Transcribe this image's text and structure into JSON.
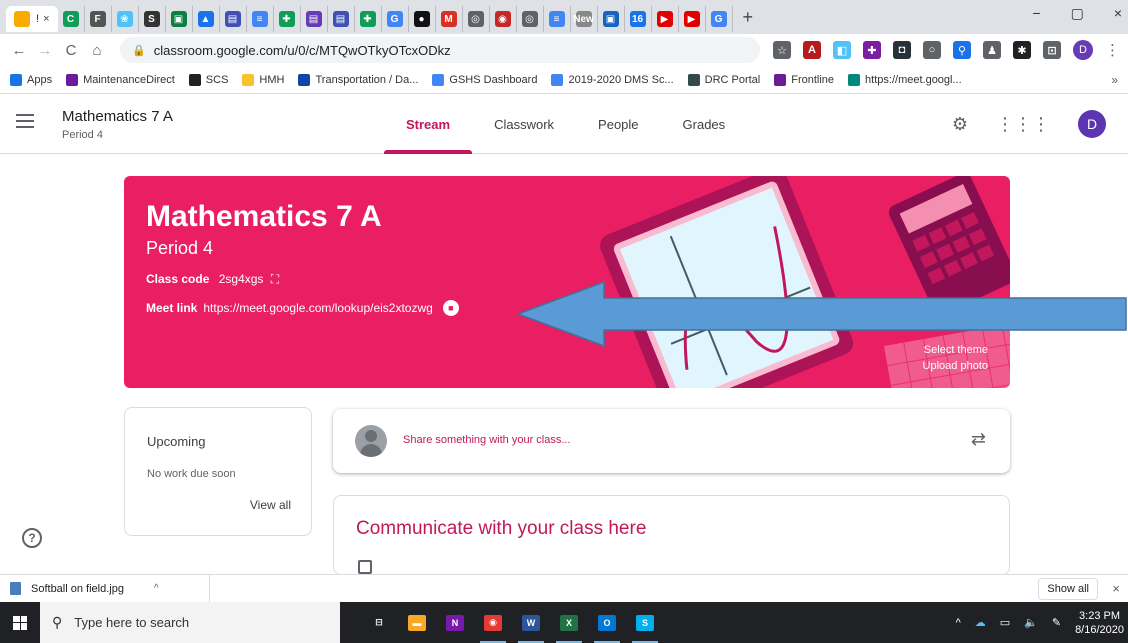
{
  "browser": {
    "tabs": [
      {
        "icon": "classroom-icon",
        "color": "#f9ab00",
        "active": true,
        "label": "!",
        "close": "×"
      },
      {
        "icon": "green-c-icon",
        "color": "#0f9d58",
        "glyph": "C"
      },
      {
        "icon": "f-icon",
        "color": "#555555",
        "glyph": "F"
      },
      {
        "icon": "blue-flower-icon",
        "color": "#4fc3f7",
        "glyph": "❀"
      },
      {
        "icon": "bold-s-icon",
        "color": "#333333",
        "glyph": "S"
      },
      {
        "icon": "slides-icon",
        "color": "#0b8043",
        "glyph": "▣"
      },
      {
        "icon": "drive-icon",
        "color": "#1a73e8",
        "glyph": "▲"
      },
      {
        "icon": "forms-icon",
        "color": "#3f51b5",
        "glyph": "▤"
      },
      {
        "icon": "docs-icon",
        "color": "#4285f4",
        "glyph": "≡"
      },
      {
        "icon": "sheets-icon",
        "color": "#0f9d58",
        "glyph": "✚"
      },
      {
        "icon": "forms-icon",
        "color": "#673ab7",
        "glyph": "▤"
      },
      {
        "icon": "forms-icon",
        "color": "#3f51b5",
        "glyph": "▤"
      },
      {
        "icon": "sheets-icon",
        "color": "#0f9d58",
        "glyph": "✚"
      },
      {
        "icon": "google-g-icon",
        "color": "#4285f4",
        "glyph": "G"
      },
      {
        "icon": "dark-circle-icon",
        "color": "#111111",
        "glyph": "●"
      },
      {
        "icon": "gmail-icon",
        "color": "#d93025",
        "glyph": "M"
      },
      {
        "icon": "chrome-icon",
        "color": "#5f6368",
        "glyph": "◎"
      },
      {
        "icon": "badge-icon",
        "color": "#c62828",
        "glyph": "◉"
      },
      {
        "icon": "chrome-icon",
        "color": "#5f6368",
        "glyph": "◎"
      },
      {
        "icon": "docs-icon",
        "color": "#4285f4",
        "glyph": "≡"
      },
      {
        "icon": "new-tab-icon",
        "color": "#888888",
        "glyph": "New"
      },
      {
        "icon": "slides-icon",
        "color": "#1565c0",
        "glyph": "▣"
      },
      {
        "icon": "calendar-icon",
        "color": "#1a73e8",
        "glyph": "16"
      },
      {
        "icon": "youtube-icon",
        "color": "#e00000",
        "glyph": "▶"
      },
      {
        "icon": "youtube-icon",
        "color": "#e00000",
        "glyph": "▶"
      },
      {
        "icon": "google-g-icon",
        "color": "#4285f4",
        "glyph": "G"
      }
    ],
    "new_tab": "+",
    "window": {
      "minimize": "−",
      "restore": "▢",
      "close": "×"
    },
    "nav": {
      "back": "←",
      "forward": "→",
      "reload": "C",
      "home": "⌂"
    },
    "url": "classroom.google.com/u/0/c/MTQwOTkyOTcxODkz",
    "extensions": [
      {
        "name": "bookmark-star-icon",
        "glyph": "☆",
        "color": "#5f6368"
      },
      {
        "name": "pdf-extension-icon",
        "glyph": "A",
        "color": "#b71c1c"
      },
      {
        "name": "screencast-extension-icon",
        "glyph": "◧",
        "color": "#4fc3f7"
      },
      {
        "name": "puzzle-extension-icon",
        "glyph": "✚",
        "color": "#7b1fa2"
      },
      {
        "name": "camera-extension-icon",
        "glyph": "◘",
        "color": "#263238"
      },
      {
        "name": "circle-extension-icon",
        "glyph": "○",
        "color": "#5f6368"
      },
      {
        "name": "link-extension-icon",
        "glyph": "⚲",
        "color": "#1a73e8"
      },
      {
        "name": "person-extension-icon",
        "glyph": "♟",
        "color": "#5f6368"
      },
      {
        "name": "extensions-puzzle-icon",
        "glyph": "✱",
        "color": "#202124"
      },
      {
        "name": "cast-icon",
        "glyph": "⊡",
        "color": "#5f6368"
      }
    ],
    "profile": "D",
    "menu": "⋮",
    "bookmarks": [
      {
        "label": "Apps",
        "color": "#1a73e8"
      },
      {
        "label": "MaintenanceDirect",
        "color": "#6a1b9a"
      },
      {
        "label": "SCS",
        "color": "#202124"
      },
      {
        "label": "HMH",
        "color": "#fbc02d"
      },
      {
        "label": "Transportation / Da...",
        "color": "#0d47a1"
      },
      {
        "label": "GSHS Dashboard",
        "color": "#4285f4"
      },
      {
        "label": "2019-2020 DMS Sc...",
        "color": "#4285f4"
      },
      {
        "label": "DRC Portal",
        "color": "#37474f"
      },
      {
        "label": "Frontline",
        "color": "#6a1b9a"
      },
      {
        "label": "https://meet.googl...",
        "color": "#00897b"
      }
    ],
    "bookmarks_more": "»"
  },
  "classroom": {
    "class_name": "Mathematics 7 A",
    "section": "Period 4",
    "tabs": [
      {
        "label": "Stream",
        "active": true
      },
      {
        "label": "Classwork",
        "active": false
      },
      {
        "label": "People",
        "active": false
      },
      {
        "label": "Grades",
        "active": false
      }
    ],
    "banner": {
      "title": "Mathematics 7 A",
      "subtitle": "Period 4",
      "class_code_label": "Class code",
      "class_code": "2sg4xgs",
      "meet_link_label": "Meet link",
      "meet_link": "https://meet.google.com/lookup/eis2xtozwg",
      "select_theme": "Select theme",
      "upload_photo": "Upload photo",
      "color": "#e91e63"
    },
    "upcoming": {
      "title": "Upcoming",
      "empty": "No work due soon",
      "view_all": "View all"
    },
    "share_placeholder": "Share something with your class...",
    "communicate_title": "Communicate with your class here",
    "accent": "#c2185b"
  },
  "downloads": {
    "file": "Softball on field.jpg",
    "chevron": "^",
    "show_all": "Show all",
    "close": "×"
  },
  "taskbar": {
    "search_placeholder": "Type here to search",
    "apps": [
      {
        "name": "task-view-icon",
        "glyph": "⊟",
        "color": "#202124",
        "running": false
      },
      {
        "name": "file-explorer-icon",
        "glyph": "▬",
        "color": "#f9a825",
        "running": false
      },
      {
        "name": "onenote-icon",
        "glyph": "N",
        "color": "#7719aa",
        "running": false
      },
      {
        "name": "chrome-taskbar-icon",
        "glyph": "◉",
        "color": "#e53935",
        "running": true
      },
      {
        "name": "word-icon",
        "glyph": "W",
        "color": "#2b579a",
        "running": true
      },
      {
        "name": "excel-icon",
        "glyph": "X",
        "color": "#217346",
        "running": true
      },
      {
        "name": "outlook-icon",
        "glyph": "O",
        "color": "#0078d4",
        "running": true
      },
      {
        "name": "skype-icon",
        "glyph": "S",
        "color": "#00aff0",
        "running": true
      }
    ],
    "time": "3:23 PM",
    "date": "8/16/2020"
  }
}
